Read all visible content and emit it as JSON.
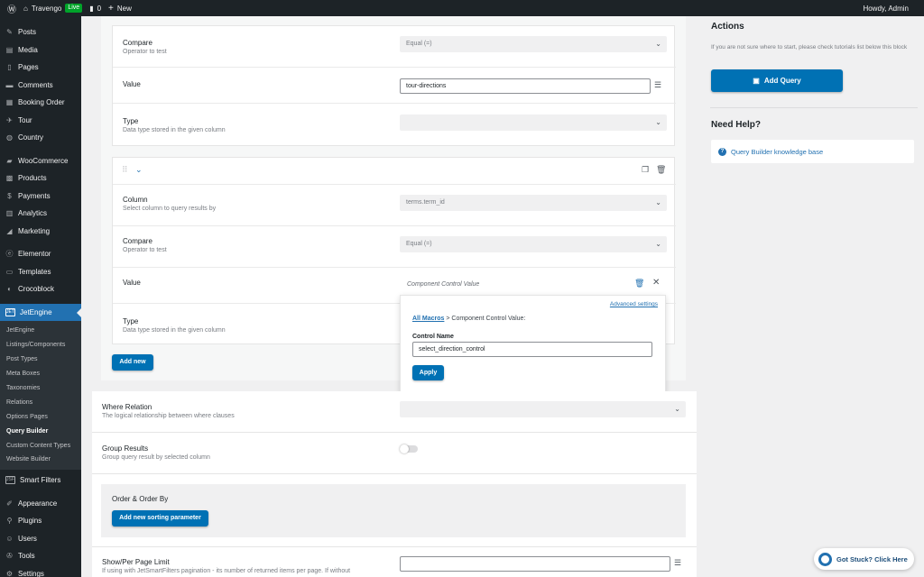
{
  "adminbar": {
    "site": "Travengo",
    "live": "Live",
    "comments": "0",
    "new": "New",
    "howdy": "Howdy, Admin"
  },
  "menu": {
    "group1": [
      {
        "label": "Posts",
        "icon": "pin-icon"
      },
      {
        "label": "Media",
        "icon": "media-icon"
      },
      {
        "label": "Pages",
        "icon": "pages-icon"
      },
      {
        "label": "Comments",
        "icon": "comments-icon"
      },
      {
        "label": "Booking Order",
        "icon": "calendar-icon"
      },
      {
        "label": "Tour",
        "icon": "tour-icon"
      },
      {
        "label": "Country",
        "icon": "globe-icon"
      }
    ],
    "group2": [
      {
        "label": "WooCommerce",
        "icon": "woo-icon"
      },
      {
        "label": "Products",
        "icon": "products-icon"
      },
      {
        "label": "Payments",
        "icon": "payments-icon"
      },
      {
        "label": "Analytics",
        "icon": "analytics-icon"
      },
      {
        "label": "Marketing",
        "icon": "marketing-icon"
      }
    ],
    "group3": [
      {
        "label": "Elementor",
        "icon": "elementor-icon"
      },
      {
        "label": "Templates",
        "icon": "templates-icon"
      },
      {
        "label": "Crocoblock",
        "icon": "crocoblock-icon"
      }
    ],
    "jetengine": "JetEngine",
    "jetengine_sub": [
      "JetEngine",
      "Listings/Components",
      "Post Types",
      "Meta Boxes",
      "Taxonomies",
      "Relations",
      "Options Pages",
      "Query Builder",
      "Custom Content Types",
      "Website Builder"
    ],
    "smart_filters": "Smart Filters",
    "group4": [
      {
        "label": "Appearance",
        "icon": "brush-icon"
      },
      {
        "label": "Plugins",
        "icon": "plugins-icon"
      },
      {
        "label": "Users",
        "icon": "users-icon"
      },
      {
        "label": "Tools",
        "icon": "tools-icon"
      },
      {
        "label": "Settings",
        "icon": "settings-icon"
      }
    ]
  },
  "clause1": {
    "compare_label": "Compare",
    "compare_desc": "Operator to test",
    "compare_value": "Equal (=)",
    "value_label": "Value",
    "value": "tour-directions",
    "type_label": "Type",
    "type_desc": "Data type stored in the given column",
    "type_value": ""
  },
  "clause2": {
    "column_label": "Column",
    "column_desc": "Select column to query results by",
    "column_value": "terms.term_id",
    "compare_label": "Compare",
    "compare_desc": "Operator to test",
    "compare_value": "Equal (=)",
    "value_label": "Value",
    "value_placeholder": "Component Control Value",
    "type_label": "Type",
    "type_desc": "Data type stored in the given column"
  },
  "popup": {
    "advanced": "Advanced settings",
    "all_macros": "All Macros",
    "crumb_sep": " > ",
    "crumb_current": "Component Control Value:",
    "control_label": "Control Name",
    "control_value": "select_direction_control",
    "apply": "Apply"
  },
  "add_new": "Add new",
  "where_relation": {
    "label": "Where Relation",
    "desc": "The logical relationship between where clauses",
    "value": ""
  },
  "group_results": {
    "label": "Group Results",
    "desc": "Group query result by selected column",
    "on": false
  },
  "order": {
    "title": "Order & Order By",
    "button": "Add new sorting parameter"
  },
  "per_page": {
    "label": "Show/Per Page Limit",
    "desc": "If using with JetSmartFilters pagination - its number of returned items per page. If without",
    "value": ""
  },
  "actions": {
    "title": "Actions",
    "text": "If you are not sure where to start, please check tutorials list below this block",
    "button": "Add Query"
  },
  "help": {
    "title": "Need Help?",
    "link": "Query Builder knowledge base"
  },
  "stuck": "Got Stuck? Click Here"
}
